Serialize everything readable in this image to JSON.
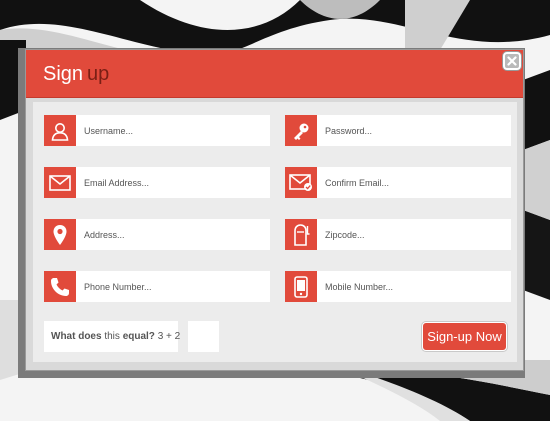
{
  "modal": {
    "title_word1": "Sign",
    "title_word2": "up",
    "close_icon": "close-icon"
  },
  "fields": {
    "username": {
      "placeholder": "Username...",
      "icon": "user-icon"
    },
    "password": {
      "placeholder": "Password...",
      "icon": "key-icon"
    },
    "email": {
      "placeholder": "Email Address...",
      "icon": "envelope-icon"
    },
    "confirm_email": {
      "placeholder": "Confirm Email...",
      "icon": "envelope-check-icon"
    },
    "address": {
      "placeholder": "Address...",
      "icon": "map-pin-icon"
    },
    "zipcode": {
      "placeholder": "Zipcode...",
      "icon": "mailbox-icon"
    },
    "phone": {
      "placeholder": "Phone Number...",
      "icon": "phone-icon"
    },
    "mobile": {
      "placeholder": "Mobile Number...",
      "icon": "mobile-icon"
    }
  },
  "captcha": {
    "what": "What does",
    "this": "this",
    "equal": "equal?",
    "expr": "3 + 2"
  },
  "submit_label": "Sign-up Now",
  "colors": {
    "accent": "#e14a3b",
    "panel": "#d9d9d9"
  }
}
